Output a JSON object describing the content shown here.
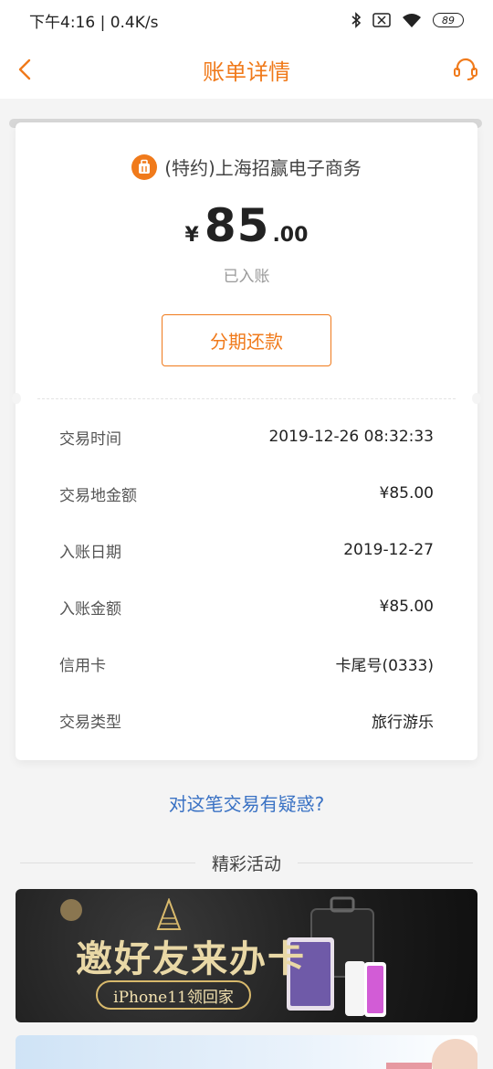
{
  "status_bar": {
    "time_speed": "下午4:16 | 0.4K/s",
    "battery": "89"
  },
  "header": {
    "title": "账单详情",
    "back_icon": "chevron-left-icon",
    "service_icon": "headset-icon"
  },
  "transaction": {
    "merchant": "(特约)上海招赢电子商务",
    "currency_symbol": "¥",
    "amount_integer": "85",
    "amount_decimal": ".00",
    "status": "已入账",
    "installment_button": "分期还款"
  },
  "details": [
    {
      "label": "交易时间",
      "value": "2019-12-26 08:32:33"
    },
    {
      "label": "交易地金额",
      "value": "¥85.00"
    },
    {
      "label": "入账日期",
      "value": "2019-12-27"
    },
    {
      "label": "入账金额",
      "value": "¥85.00"
    },
    {
      "label": "信用卡",
      "value": "卡尾号(0333)"
    },
    {
      "label": "交易类型",
      "value": "旅行游乐"
    }
  ],
  "question_link": "对这笔交易有疑惑?",
  "activities": {
    "title": "精彩活动",
    "banner1_main": "邀好友来办卡",
    "banner1_sub": "iPhone11领回家"
  },
  "colors": {
    "accent": "#f07a1b",
    "link": "#3a72c4"
  }
}
